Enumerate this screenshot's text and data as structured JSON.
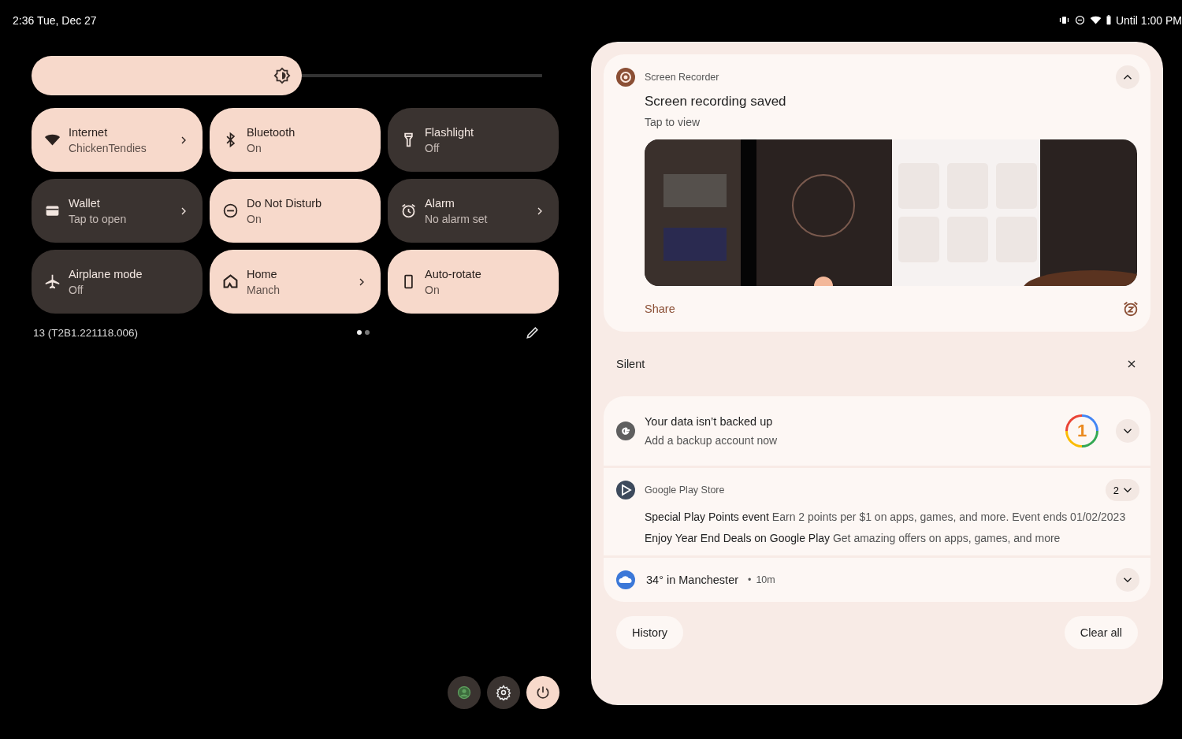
{
  "status_bar": {
    "time": "2:36 Tue, Dec 27",
    "right_text": "Until 1:00 PM"
  },
  "brightness": {
    "level": 0.53
  },
  "tiles": [
    {
      "label": "Internet",
      "sub": "ChickenTendies",
      "kind": "wifi",
      "on": true,
      "chevron": true
    },
    {
      "label": "Bluetooth",
      "sub": "On",
      "kind": "bluetooth",
      "on": true,
      "chevron": false
    },
    {
      "label": "Flashlight",
      "sub": "Off",
      "kind": "flashlight",
      "on": false,
      "chevron": false
    },
    {
      "label": "Wallet",
      "sub": "Tap to open",
      "kind": "wallet",
      "on": false,
      "chevron": true
    },
    {
      "label": "Do Not Disturb",
      "sub": "On",
      "kind": "dnd",
      "on": true,
      "chevron": false
    },
    {
      "label": "Alarm",
      "sub": "No alarm set",
      "kind": "alarm",
      "on": false,
      "chevron": true
    },
    {
      "label": "Airplane mode",
      "sub": "Off",
      "kind": "airplane",
      "on": false,
      "chevron": false
    },
    {
      "label": "Home",
      "sub": "Manch",
      "kind": "home",
      "on": true,
      "chevron": true
    },
    {
      "label": "Auto-rotate",
      "sub": "On",
      "kind": "rotate",
      "on": true,
      "chevron": false
    }
  ],
  "build": "13 (T2B1.221118.006)",
  "pages": [
    {
      "selected": true
    },
    {
      "selected": false
    }
  ],
  "bottom_buttons": [
    {
      "kind": "user"
    },
    {
      "kind": "settings"
    },
    {
      "kind": "power"
    }
  ],
  "recorder": {
    "app": "Screen Recorder",
    "title": "Screen recording saved",
    "text": "Tap to view",
    "expanded": true,
    "action": "Share"
  },
  "silent": {
    "header": "Silent"
  },
  "notifications": [
    {
      "kind": "backup",
      "title": "Your data isn’t backed up",
      "text": "Add a backup account now",
      "badge": "1",
      "expanded": false
    },
    {
      "kind": "play",
      "app": "Google Play Store",
      "count": "2",
      "expanded": false,
      "lines": [
        "**Special Play Points event** Earn 2 points per $1 on apps, games, and more. Event ends 01/02/2023",
        "**Enjoy Year End Deals on Google Play** Get amazing offers on apps, games, and more"
      ]
    },
    {
      "kind": "weather",
      "title": "34° in Manchester",
      "separator": "•",
      "time": "10m",
      "expanded": false
    }
  ],
  "footer": [
    "History",
    "Clear all"
  ]
}
